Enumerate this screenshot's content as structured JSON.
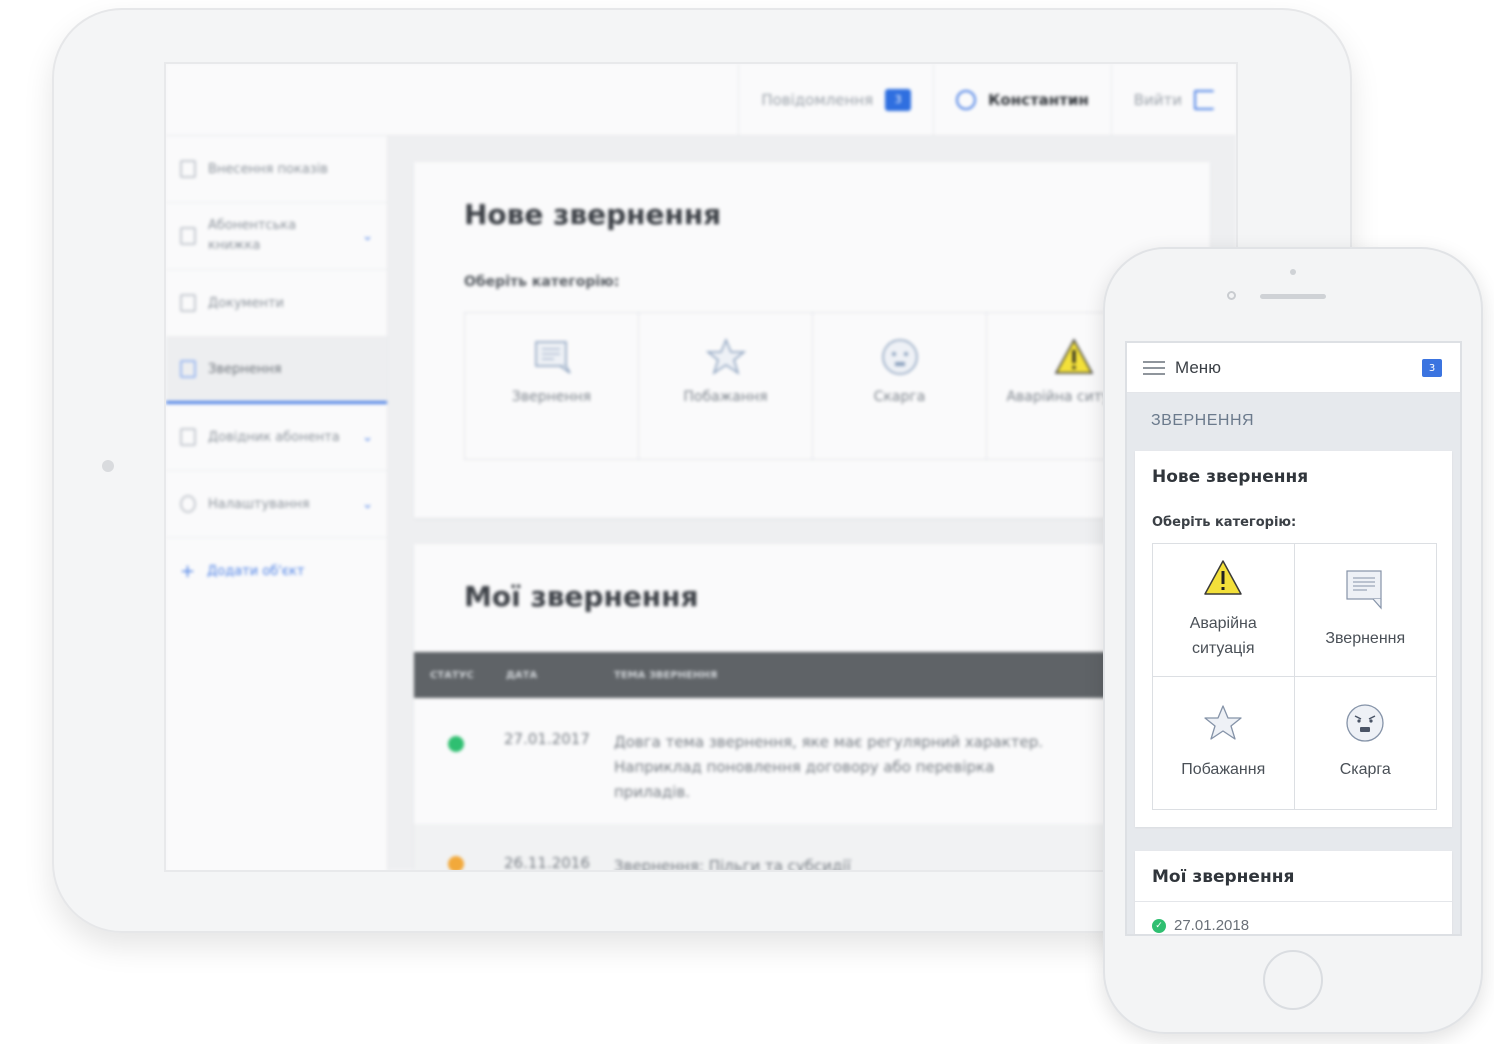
{
  "tablet": {
    "header": {
      "messages_label": "Повідомлення",
      "messages_count": "3",
      "user_name": "Константин",
      "logout_label": "Вийти"
    },
    "sidebar": {
      "items": [
        {
          "label": "Внесення показів",
          "has_submenu": false
        },
        {
          "label": "Абонентська книжка",
          "has_submenu": true
        },
        {
          "label": "Документи",
          "has_submenu": false
        },
        {
          "label": "Звернення",
          "has_submenu": false,
          "active": true
        },
        {
          "label": "Довідник абонента",
          "has_submenu": true
        },
        {
          "label": "Налаштування",
          "has_submenu": true
        }
      ],
      "add_object_label": "Додати об'єкт"
    },
    "new_request": {
      "title": "Нове звернення",
      "choose_label": "Оберіть категорію:",
      "categories": [
        {
          "label": "Звернення",
          "icon": "message-icon"
        },
        {
          "label": "Побажання",
          "icon": "star-icon"
        },
        {
          "label": "Скарга",
          "icon": "angry-face-icon"
        },
        {
          "label": "Аварійна ситуація",
          "icon": "warning-icon"
        }
      ]
    },
    "my_requests": {
      "title": "Мої звернення",
      "columns": [
        "СТАТУС",
        "ДАТА",
        "ТЕМА ЗВЕРНЕННЯ"
      ],
      "rows": [
        {
          "status": "done",
          "status_color": "#2fbf71",
          "date": "27.01.2017",
          "subject": "Довга тема звернення, яке має регулярний характер. Наприклад поновлення договору або перевірка приладів."
        },
        {
          "status": "pending",
          "status_color": "#f2a93b",
          "date": "26.11.2016",
          "subject": "Звернення: Пільги та субсидії"
        }
      ]
    }
  },
  "phone": {
    "menu_label": "Меню",
    "messages_count": "3",
    "section_label": "ЗВЕРНЕННЯ",
    "new_request": {
      "title": "Нове звернення",
      "choose_label": "Оберіть категорію:",
      "categories": [
        {
          "label": "Аварійна ситуація",
          "icon": "warning-icon"
        },
        {
          "label": "Звернення",
          "icon": "message-icon"
        },
        {
          "label": "Побажання",
          "icon": "star-icon"
        },
        {
          "label": "Скарга",
          "icon": "angry-face-icon"
        }
      ]
    },
    "my_requests": {
      "title": "Мої звернення",
      "first_date": "27.01.2018",
      "first_status": "done"
    }
  },
  "colors": {
    "accent": "#3b74e0",
    "success": "#2fbf71",
    "warning": "#f2a93b",
    "table_header": "#5f6367"
  }
}
